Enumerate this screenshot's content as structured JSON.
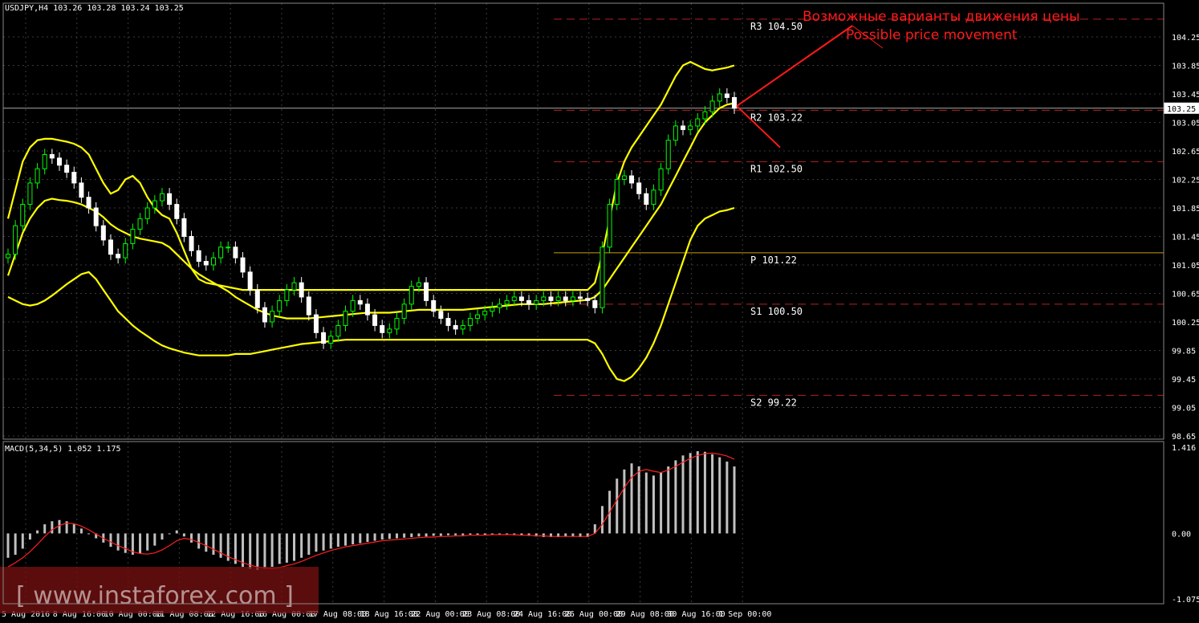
{
  "colors": {
    "background": "#000000",
    "grid": "#3a3a3a",
    "bull": "#00ff00",
    "bear": "#ffffff",
    "bollinger": "#ffff00",
    "level": "#b22222",
    "pivot": "#c8a000",
    "annotation": "#ff1a1a",
    "tenkan": "#ff3030",
    "kijun": "#3030ff",
    "chikou": "#22aa22",
    "macd_hist": "#c0c0c0",
    "macd_signal": "#ff2020"
  },
  "header": {
    "symbol_label": "USDJPY,H4  103.26 103.28 103.24 103.25"
  },
  "annotation": {
    "line1": "Возможные варианты движения цены",
    "line2": "Possible price movement"
  },
  "watermark": {
    "text": "[ www.instaforex.com ]"
  },
  "levels": [
    {
      "label": "R3  104.50",
      "price": 104.5,
      "style": "dash"
    },
    {
      "label": "R2  103.22",
      "price": 103.22,
      "style": "dash"
    },
    {
      "label": "R1  102.50",
      "price": 102.5,
      "style": "dash"
    },
    {
      "label": "P  101.22",
      "price": 101.22,
      "style": "solid"
    },
    {
      "label": "S1  100.50",
      "price": 100.5,
      "style": "dash"
    },
    {
      "label": "S2  99.22",
      "price": 99.22,
      "style": "dash"
    }
  ],
  "current_price": {
    "label": "103.25",
    "value": 103.25
  },
  "chart_data": [
    {
      "type": "candlestick",
      "title": "USDJPY,H4  103.26 103.28 103.24 103.25",
      "ylim": [
        98.65,
        104.45
      ],
      "y_ticks": [
        "104.25",
        "103.85",
        "103.45",
        "103.05",
        "102.65",
        "102.25",
        "101.85",
        "101.45",
        "101.05",
        "100.65",
        "100.25",
        "99.85",
        "99.45",
        "99.05",
        "98.65"
      ],
      "y_tick_values": [
        104.25,
        103.85,
        103.45,
        103.05,
        102.65,
        102.25,
        101.85,
        101.45,
        101.05,
        100.65,
        100.25,
        99.85,
        99.45,
        99.05,
        98.65
      ],
      "x_ticks": [
        "5 Aug 2016",
        "8 Aug 16:00",
        "10 Aug 00:00",
        "11 Aug 08:00",
        "12 Aug 16:00",
        "16 Aug 00:00",
        "17 Aug 08:00",
        "18 Aug 16:00",
        "22 Aug 00:00",
        "23 Aug 08:00",
        "24 Aug 16:00",
        "26 Aug 00:00",
        "29 Aug 08:00",
        "30 Aug 16:00",
        "1 Sep 00:00"
      ],
      "close": [
        101.2,
        101.6,
        101.9,
        102.2,
        102.4,
        102.6,
        102.55,
        102.45,
        102.35,
        102.2,
        102.0,
        101.85,
        101.6,
        101.4,
        101.2,
        101.15,
        101.35,
        101.55,
        101.7,
        101.85,
        101.95,
        102.05,
        101.9,
        101.7,
        101.45,
        101.25,
        101.1,
        101.05,
        101.15,
        101.3,
        101.3,
        101.15,
        100.95,
        100.7,
        100.45,
        100.25,
        100.4,
        100.55,
        100.7,
        100.8,
        100.6,
        100.35,
        100.1,
        99.95,
        100.05,
        100.2,
        100.4,
        100.55,
        100.5,
        100.35,
        100.2,
        100.1,
        100.15,
        100.3,
        100.5,
        100.75,
        100.8,
        100.55,
        100.4,
        100.3,
        100.2,
        100.15,
        100.2,
        100.3,
        100.35,
        100.4,
        100.45,
        100.5,
        100.55,
        100.6,
        100.55,
        100.5,
        100.55,
        100.6,
        100.55,
        100.6,
        100.55,
        100.6,
        100.58,
        100.55,
        100.45,
        101.3,
        101.9,
        102.25,
        102.3,
        102.2,
        102.05,
        101.9,
        102.1,
        102.4,
        102.8,
        103.0,
        102.95,
        103.0,
        103.1,
        103.2,
        103.35,
        103.45,
        103.4,
        103.25
      ],
      "ohlc_note": "candles derived from close series with small wicks",
      "bollinger": {
        "middle": [
          100.9,
          101.2,
          101.5,
          101.7,
          101.85,
          101.95,
          101.98,
          101.96,
          101.95,
          101.93,
          101.9,
          101.85,
          101.8,
          101.72,
          101.62,
          101.55,
          101.5,
          101.45,
          101.42,
          101.4,
          101.38,
          101.36,
          101.3,
          101.2,
          101.1,
          101.0,
          100.92,
          100.86,
          100.8,
          100.74,
          100.68,
          100.6,
          100.54,
          100.48,
          100.42,
          100.38,
          100.34,
          100.32,
          100.3,
          100.3,
          100.3,
          100.3,
          100.31,
          100.32,
          100.33,
          100.34,
          100.35,
          100.36,
          100.37,
          100.38,
          100.38,
          100.38,
          100.38,
          100.39,
          100.4,
          100.41,
          100.42,
          100.42,
          100.42,
          100.42,
          100.42,
          100.42,
          100.42,
          100.43,
          100.44,
          100.45,
          100.46,
          100.47,
          100.48,
          100.49,
          100.5,
          100.5,
          100.5,
          100.5,
          100.51,
          100.52,
          100.53,
          100.54,
          100.55,
          100.56,
          100.6,
          100.7,
          100.85,
          101.0,
          101.15,
          101.3,
          101.45,
          101.6,
          101.75,
          101.9,
          102.1,
          102.3,
          102.5,
          102.7,
          102.9,
          103.05,
          103.15,
          103.25,
          103.3,
          103.32
        ],
        "upper": [
          101.7,
          102.1,
          102.5,
          102.7,
          102.8,
          102.82,
          102.82,
          102.8,
          102.78,
          102.75,
          102.7,
          102.6,
          102.4,
          102.2,
          102.05,
          102.1,
          102.25,
          102.3,
          102.2,
          102.0,
          101.85,
          101.75,
          101.7,
          101.5,
          101.25,
          101.0,
          100.85,
          100.8,
          100.78,
          100.76,
          100.74,
          100.72,
          100.7,
          100.7,
          100.7,
          100.7,
          100.7,
          100.7,
          100.7,
          100.7,
          100.7,
          100.7,
          100.7,
          100.7,
          100.7,
          100.7,
          100.7,
          100.7,
          100.7,
          100.7,
          100.7,
          100.7,
          100.7,
          100.7,
          100.7,
          100.7,
          100.7,
          100.7,
          100.7,
          100.7,
          100.7,
          100.7,
          100.7,
          100.7,
          100.7,
          100.7,
          100.7,
          100.7,
          100.7,
          100.7,
          100.7,
          100.7,
          100.7,
          100.7,
          100.7,
          100.7,
          100.7,
          100.7,
          100.7,
          100.7,
          100.8,
          101.2,
          101.7,
          102.2,
          102.5,
          102.7,
          102.85,
          103.0,
          103.15,
          103.3,
          103.5,
          103.7,
          103.85,
          103.9,
          103.85,
          103.8,
          103.78,
          103.8,
          103.82,
          103.85
        ],
        "lower": [
          100.6,
          100.55,
          100.5,
          100.48,
          100.5,
          100.55,
          100.62,
          100.7,
          100.78,
          100.85,
          100.92,
          100.95,
          100.85,
          100.7,
          100.55,
          100.4,
          100.3,
          100.2,
          100.12,
          100.05,
          99.98,
          99.92,
          99.88,
          99.85,
          99.82,
          99.8,
          99.78,
          99.78,
          99.78,
          99.78,
          99.78,
          99.8,
          99.8,
          99.8,
          99.82,
          99.84,
          99.86,
          99.88,
          99.9,
          99.92,
          99.94,
          99.95,
          99.96,
          99.97,
          99.98,
          99.99,
          100.0,
          100.0,
          100.0,
          100.0,
          100.0,
          100.0,
          100.0,
          100.0,
          100.0,
          100.0,
          100.0,
          100.0,
          100.0,
          100.0,
          100.0,
          100.0,
          100.0,
          100.0,
          100.0,
          100.0,
          100.0,
          100.0,
          100.0,
          100.0,
          100.0,
          100.0,
          100.0,
          100.0,
          100.0,
          100.0,
          100.0,
          100.0,
          100.0,
          100.0,
          99.95,
          99.8,
          99.6,
          99.45,
          99.42,
          99.48,
          99.6,
          99.75,
          99.95,
          100.2,
          100.5,
          100.8,
          101.1,
          101.4,
          101.6,
          101.7,
          101.75,
          101.8,
          101.82,
          101.85
        ]
      }
    },
    {
      "type": "bar",
      "title": "MACD(5,34,5) 1.052 1.175",
      "ylim": [
        -1.075,
        1.416
      ],
      "y_ticks": [
        "1.416",
        "0.00",
        "-1.075"
      ],
      "y_tick_values": [
        1.416,
        0.0,
        -1.075
      ],
      "series": [
        {
          "name": "MACD",
          "values": [
            -0.4,
            -0.35,
            -0.25,
            -0.1,
            0.05,
            0.15,
            0.2,
            0.22,
            0.2,
            0.15,
            0.08,
            0.0,
            -0.08,
            -0.15,
            -0.22,
            -0.28,
            -0.32,
            -0.35,
            -0.33,
            -0.28,
            -0.2,
            -0.1,
            0.0,
            0.05,
            -0.05,
            -0.15,
            -0.25,
            -0.3,
            -0.35,
            -0.4,
            -0.45,
            -0.5,
            -0.55,
            -0.58,
            -0.6,
            -0.58,
            -0.55,
            -0.5,
            -0.48,
            -0.45,
            -0.4,
            -0.35,
            -0.3,
            -0.28,
            -0.25,
            -0.22,
            -0.2,
            -0.18,
            -0.16,
            -0.14,
            -0.12,
            -0.1,
            -0.09,
            -0.08,
            -0.07,
            -0.06,
            -0.05,
            -0.05,
            -0.04,
            -0.04,
            -0.03,
            -0.03,
            -0.03,
            -0.02,
            -0.02,
            -0.02,
            -0.02,
            -0.02,
            -0.02,
            -0.03,
            -0.03,
            -0.04,
            -0.05,
            -0.06,
            -0.06,
            -0.06,
            -0.05,
            -0.05,
            -0.06,
            -0.06,
            0.15,
            0.45,
            0.7,
            0.9,
            1.05,
            1.15,
            1.1,
            1.0,
            0.95,
            1.0,
            1.1,
            1.2,
            1.28,
            1.32,
            1.35,
            1.34,
            1.3,
            1.25,
            1.18,
            1.1
          ]
        },
        {
          "name": "Signal",
          "values": [
            -0.55,
            -0.48,
            -0.4,
            -0.3,
            -0.18,
            -0.05,
            0.06,
            0.13,
            0.17,
            0.16,
            0.12,
            0.06,
            -0.01,
            -0.08,
            -0.14,
            -0.2,
            -0.25,
            -0.3,
            -0.33,
            -0.34,
            -0.32,
            -0.27,
            -0.2,
            -0.12,
            -0.08,
            -0.1,
            -0.15,
            -0.2,
            -0.26,
            -0.32,
            -0.38,
            -0.43,
            -0.48,
            -0.52,
            -0.55,
            -0.57,
            -0.58,
            -0.56,
            -0.53,
            -0.5,
            -0.46,
            -0.41,
            -0.36,
            -0.32,
            -0.28,
            -0.25,
            -0.22,
            -0.2,
            -0.18,
            -0.16,
            -0.14,
            -0.12,
            -0.11,
            -0.1,
            -0.09,
            -0.08,
            -0.07,
            -0.06,
            -0.06,
            -0.05,
            -0.05,
            -0.04,
            -0.04,
            -0.03,
            -0.03,
            -0.03,
            -0.02,
            -0.02,
            -0.02,
            -0.02,
            -0.03,
            -0.03,
            -0.04,
            -0.04,
            -0.05,
            -0.05,
            -0.05,
            -0.05,
            -0.05,
            -0.05,
            0.0,
            0.15,
            0.35,
            0.55,
            0.75,
            0.92,
            1.02,
            1.05,
            1.02,
            1.0,
            1.04,
            1.1,
            1.17,
            1.23,
            1.28,
            1.31,
            1.32,
            1.3,
            1.27,
            1.22
          ]
        }
      ]
    }
  ]
}
